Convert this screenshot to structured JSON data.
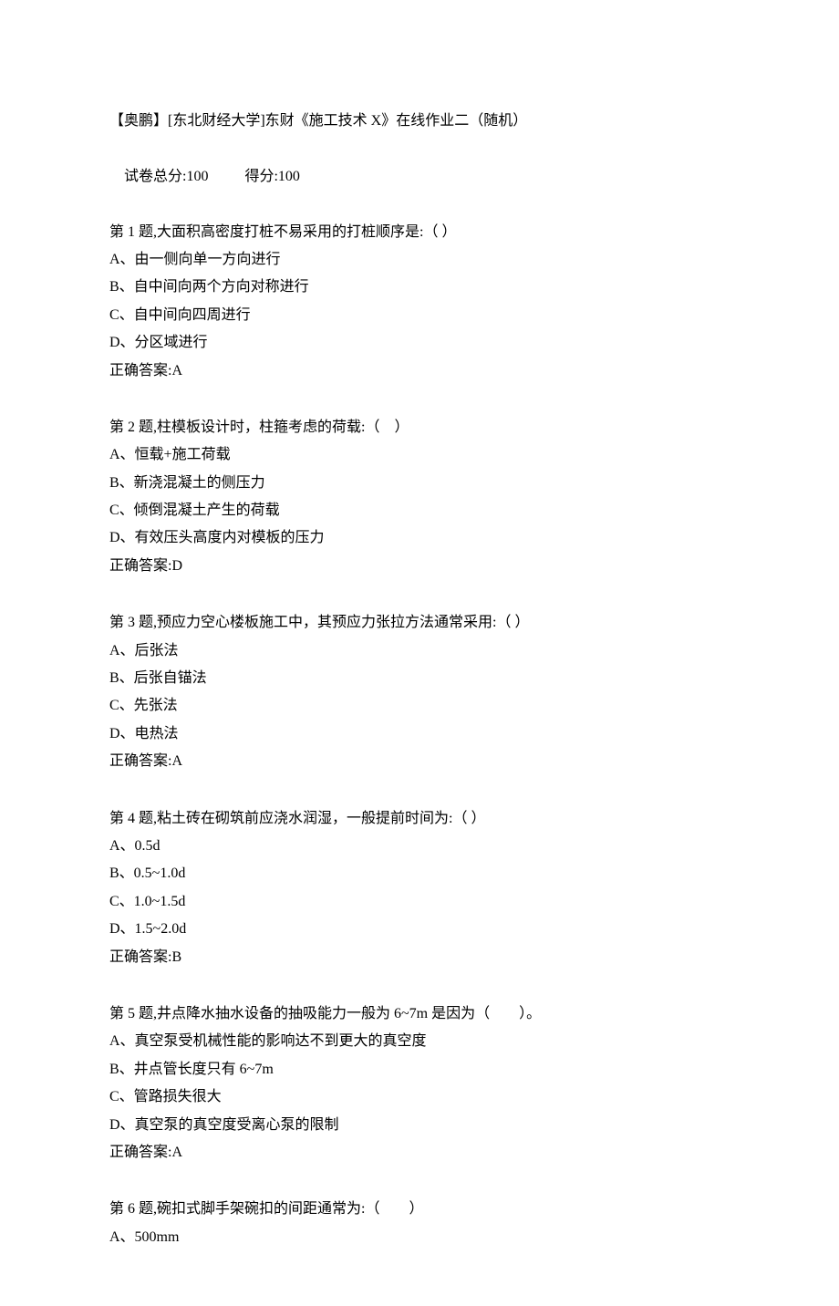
{
  "header": {
    "title": "【奥鹏】[东北财经大学]东财《施工技术 X》在线作业二（随机）",
    "score_prefix": "试卷总分:",
    "score_total": "100",
    "score_gain_prefix": "得分:",
    "score_gain": "100"
  },
  "questions": [
    {
      "stem": "第 1 题,大面积高密度打桩不易采用的打桩顺序是:（ ）",
      "options": [
        "A、由一侧向单一方向进行",
        "B、自中间向两个方向对称进行",
        "C、自中间向四周进行",
        "D、分区域进行"
      ],
      "answer_label": "正确答案:",
      "answer": "A"
    },
    {
      "stem": "第 2 题,柱模板设计时，柱箍考虑的荷载:（　）",
      "options": [
        "A、恒载+施工荷载",
        "B、新浇混凝土的侧压力",
        "C、倾倒混凝土产生的荷载",
        "D、有效压头高度内对模板的压力"
      ],
      "answer_label": "正确答案:",
      "answer": "D"
    },
    {
      "stem": "第 3 题,预应力空心楼板施工中，其预应力张拉方法通常采用:（ ）",
      "options": [
        "A、后张法",
        "B、后张自锚法",
        "C、先张法",
        "D、电热法"
      ],
      "answer_label": "正确答案:",
      "answer": "A"
    },
    {
      "stem": "第 4 题,粘土砖在砌筑前应浇水润湿，一般提前时间为:（ ）",
      "options": [
        "A、0.5d",
        "B、0.5~1.0d",
        "C、1.0~1.5d",
        "D、1.5~2.0d"
      ],
      "answer_label": "正确答案:",
      "answer": "B"
    },
    {
      "stem": "第 5 题,井点降水抽水设备的抽吸能力一般为 6~7m 是因为（　　）。",
      "options": [
        "A、真空泵受机械性能的影响达不到更大的真空度",
        "B、井点管长度只有 6~7m",
        "C、管路损失很大",
        "D、真空泵的真空度受离心泵的限制"
      ],
      "answer_label": "正确答案:",
      "answer": "A"
    },
    {
      "stem": "第 6 题,碗扣式脚手架碗扣的间距通常为:（　　）",
      "options": [
        "A、500mm"
      ],
      "answer_label": "",
      "answer": ""
    }
  ]
}
